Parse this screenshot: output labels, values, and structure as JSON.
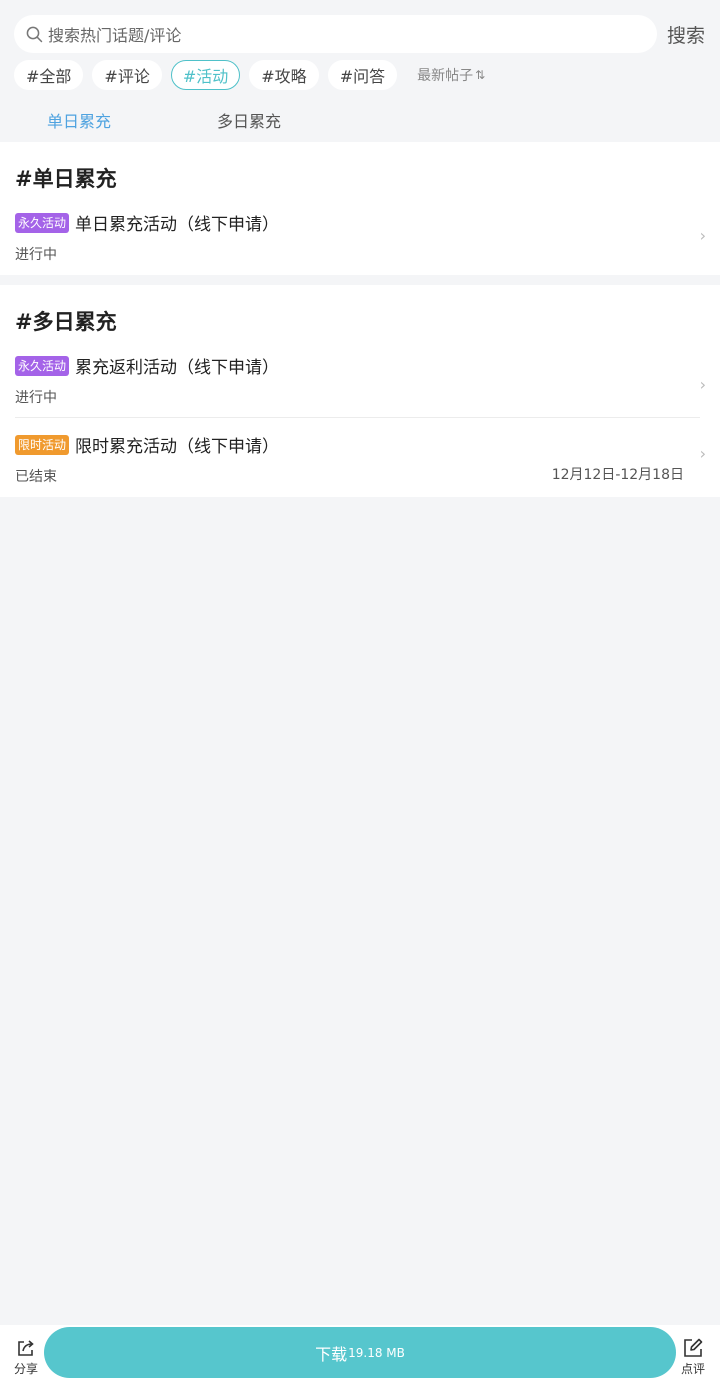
{
  "search": {
    "placeholder": "搜索热门话题/评论",
    "button_label": "搜索"
  },
  "tags": [
    {
      "label": "#全部",
      "active": false
    },
    {
      "label": "#评论",
      "active": false
    },
    {
      "label": "#活动",
      "active": true
    },
    {
      "label": "#攻略",
      "active": false
    },
    {
      "label": "#问答",
      "active": false
    }
  ],
  "sort": {
    "label": "最新帖子",
    "icon": "sort-arrows-icon"
  },
  "subtabs": [
    {
      "label": "单日累充",
      "active": true
    },
    {
      "label": "多日累充",
      "active": false
    }
  ],
  "sections": [
    {
      "title": "#单日累充",
      "items": [
        {
          "badge": "永久活动",
          "badge_color": "#a463e8",
          "title": "单日累充活动（线下申请）",
          "status": "进行中",
          "date": ""
        }
      ]
    },
    {
      "title": "#多日累充",
      "items": [
        {
          "badge": "永久活动",
          "badge_color": "#a463e8",
          "title": "累充返利活动（线下申请）",
          "status": "进行中",
          "date": ""
        },
        {
          "badge": "限时活动",
          "badge_color": "#f09a2e",
          "title": "限时累充活动（线下申请）",
          "status": "已结束",
          "date": "12月12日-12月18日"
        }
      ]
    }
  ],
  "bottom": {
    "share_label": "分享",
    "download_label": "下载",
    "download_size": "19.18 MB",
    "review_label": "点评"
  },
  "colors": {
    "accent": "#4fc1c9",
    "active_subtab": "#4fa3e0",
    "download_button": "#56c6cd",
    "badge_permanent": "#a463e8",
    "badge_limited": "#f09a2e"
  }
}
